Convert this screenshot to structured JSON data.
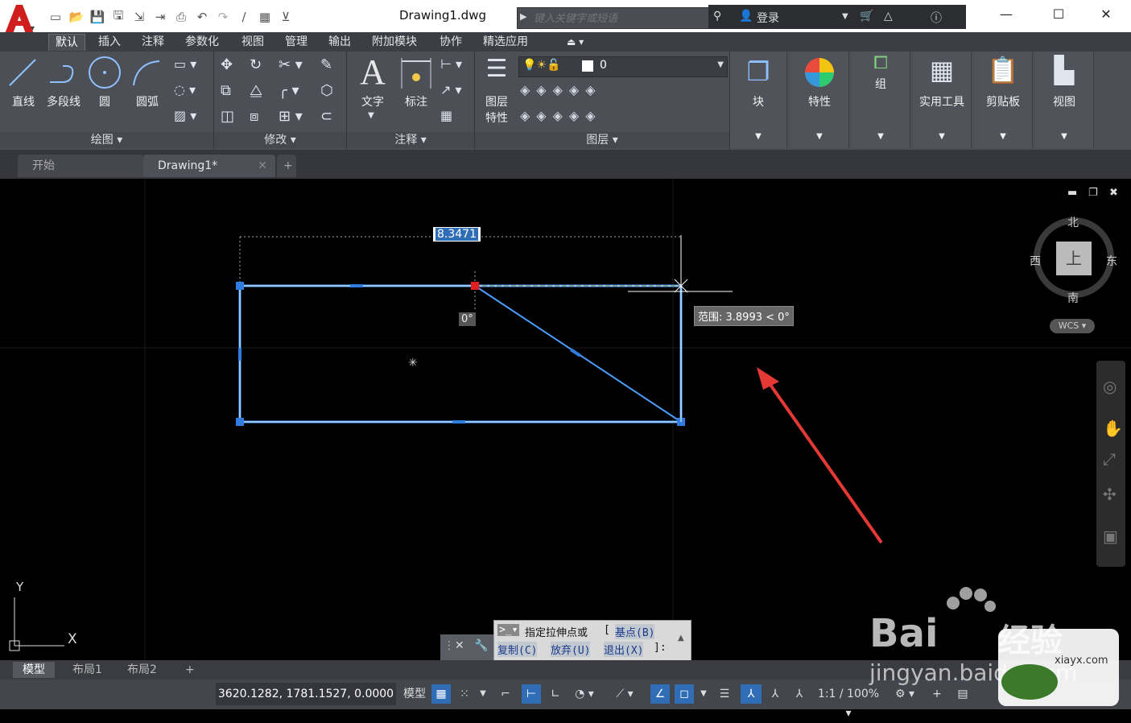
{
  "titlebar": {
    "doc_title": "Drawing1.dwg",
    "search_placeholder": "键入关键字或短语",
    "login": "登录"
  },
  "ribbon_tabs": [
    "默认",
    "插入",
    "注释",
    "参数化",
    "视图",
    "管理",
    "输出",
    "附加模块",
    "协作",
    "精选应用"
  ],
  "panels": {
    "draw": {
      "title": "绘图 ▾",
      "line": "直线",
      "polyline": "多段线",
      "circle": "圆",
      "arc": "圆弧"
    },
    "modify": {
      "title": "修改 ▾"
    },
    "annotation": {
      "title": "注释 ▾",
      "text": "文字",
      "dimension": "标注"
    },
    "layers": {
      "title": "图层 ▾",
      "layer_props_1": "图层",
      "layer_props_2": "特性",
      "current_layer": "0"
    },
    "block": "块",
    "properties": "特性",
    "group": "组",
    "utilities": "实用工具",
    "clipboard": "剪贴板",
    "view": "视图"
  },
  "file_tabs": {
    "start": "开始",
    "drawing": "Drawing1*",
    "close": "✕",
    "add": "+"
  },
  "viewport": {
    "dim_value": "8.3471",
    "angle_label": "0°",
    "range_tooltip": "范围: 3.8993 < 0°",
    "compass": {
      "north": "北",
      "south": "南",
      "east": "东",
      "west": "西",
      "top": "上",
      "wcs": "WCS"
    },
    "ucs_x": "X",
    "ucs_y": "Y"
  },
  "command": {
    "prompt": "指定拉伸点或",
    "base": "基点(B)",
    "copy": "复制(C)",
    "undo": "放弃(U)",
    "exit": "退出(X)",
    "end": "]:"
  },
  "layout_tabs": [
    "模型",
    "布局1",
    "布局2"
  ],
  "status": {
    "coords": "3620.1282, 1781.1527, 0.0000",
    "model": "模型",
    "scale": "1:1 / 100%"
  },
  "watermark": {
    "brand": "Bai",
    "brand2": "经验",
    "url": "jingyan.baidu.com",
    "site": "xiayx.com"
  },
  "colors": {
    "accent": "#2f6db6",
    "selection": "#4a9eff",
    "arrow": "#e53935"
  }
}
